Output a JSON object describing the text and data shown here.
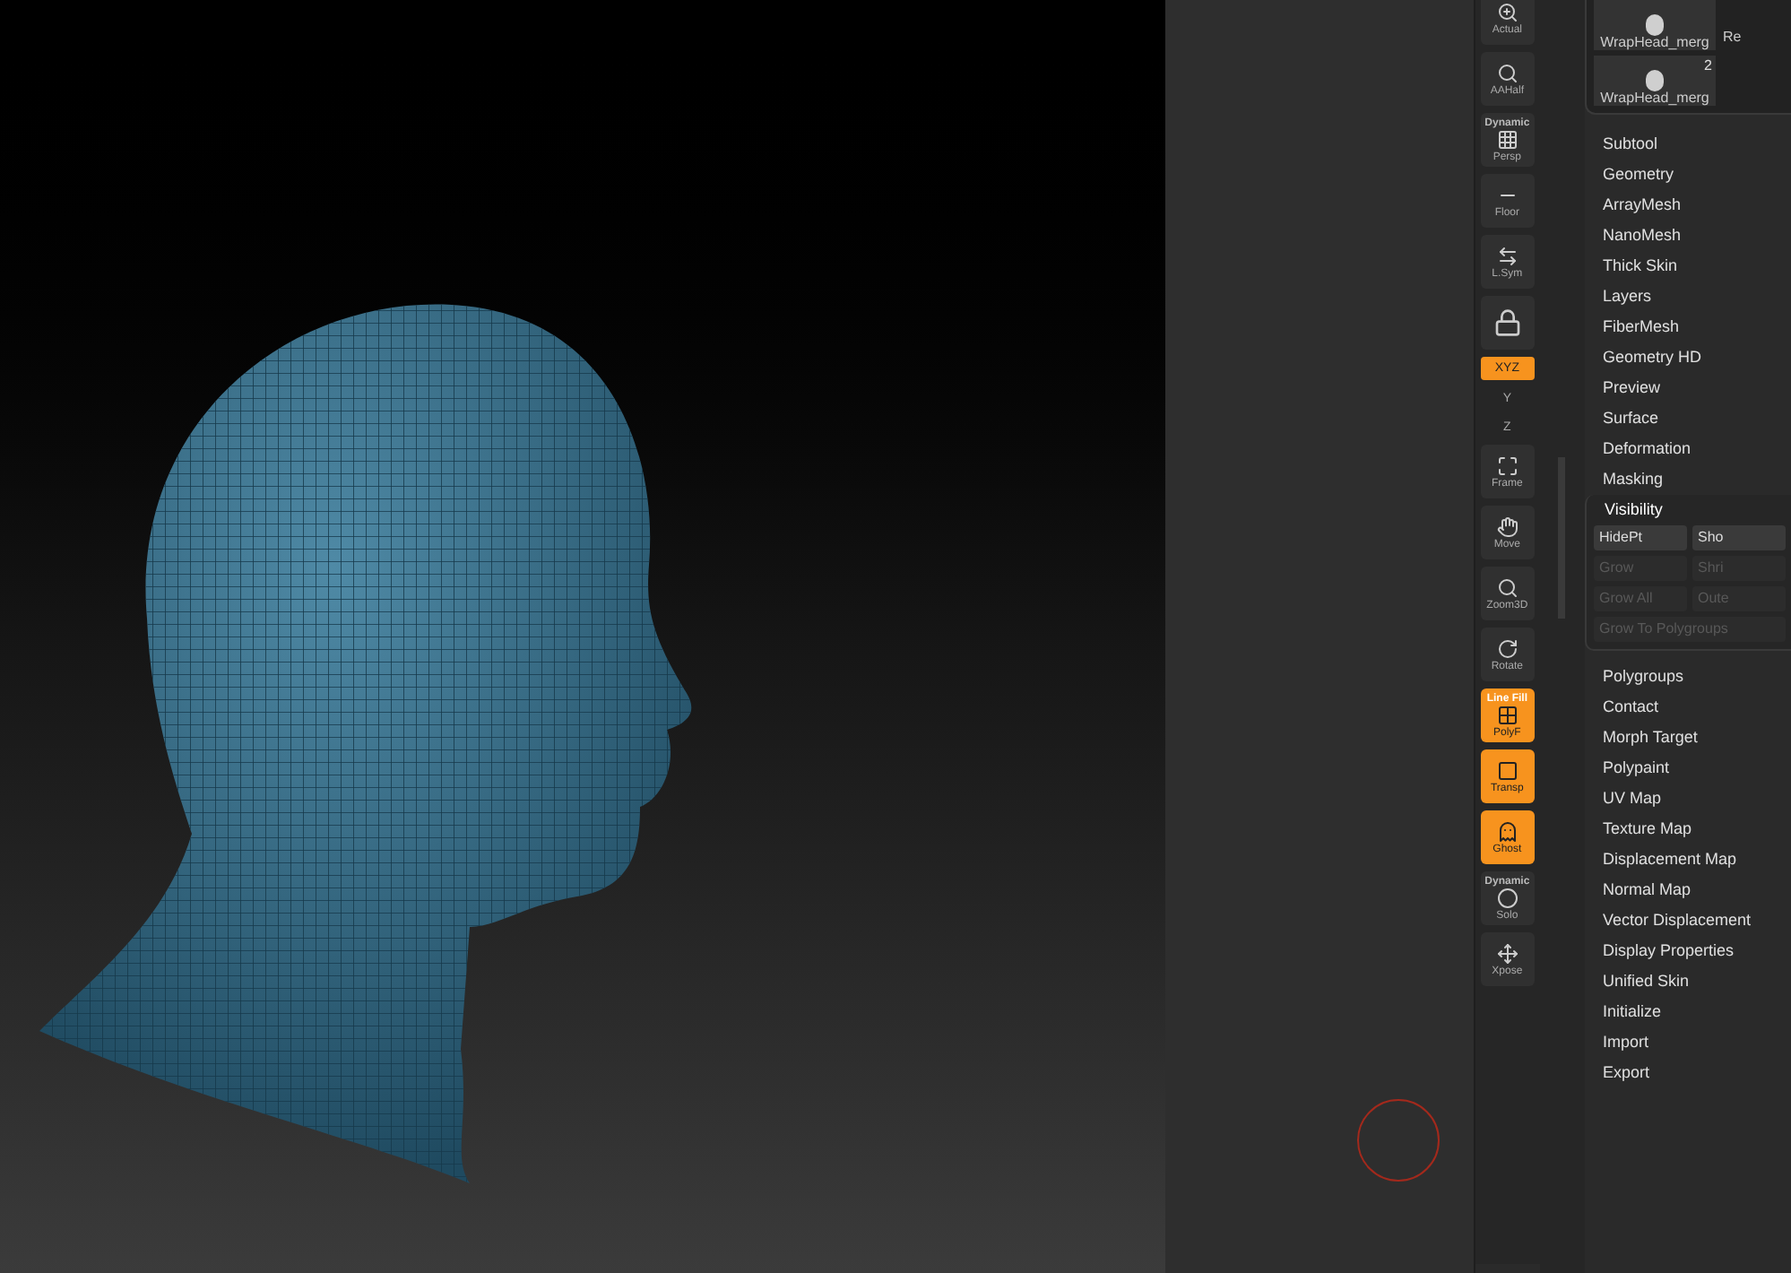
{
  "shelf": [
    {
      "kind": "button",
      "label": "Actual",
      "active": false
    },
    {
      "kind": "button",
      "label": "AAHalf",
      "active": false
    },
    {
      "kind": "button",
      "label": "Persp",
      "caption": "Dynamic",
      "active": false
    },
    {
      "kind": "button",
      "label": "Floor",
      "active": false
    },
    {
      "kind": "button",
      "label": "L.Sym",
      "active": false
    },
    {
      "kind": "icon",
      "active": false
    },
    {
      "kind": "pill",
      "label": "XYZ",
      "active": true
    },
    {
      "kind": "mini",
      "label": "Y",
      "active": false
    },
    {
      "kind": "mini",
      "label": "Z",
      "active": false
    },
    {
      "kind": "button",
      "label": "Frame",
      "active": false
    },
    {
      "kind": "button",
      "label": "Move",
      "active": false
    },
    {
      "kind": "button",
      "label": "Zoom3D",
      "active": false
    },
    {
      "kind": "button",
      "label": "Rotate",
      "active": false
    },
    {
      "kind": "button",
      "label": "PolyF",
      "caption": "Line Fill",
      "active": true
    },
    {
      "kind": "button",
      "label": "Transp",
      "active": true
    },
    {
      "kind": "button",
      "label": "Ghost",
      "active": true
    },
    {
      "kind": "button",
      "label": "Solo",
      "caption": "Dynamic",
      "active": false
    },
    {
      "kind": "button",
      "label": "Xpose",
      "active": false
    }
  ],
  "subtools": [
    {
      "name": "WrapHead_merg"
    },
    {
      "name": "WrapHead_merg",
      "count": "2"
    }
  ],
  "subtool_side_text": "Re",
  "menu": [
    {
      "label": "Subtool"
    },
    {
      "label": "Geometry"
    },
    {
      "label": "ArrayMesh"
    },
    {
      "label": "NanoMesh"
    },
    {
      "label": "Thick Skin"
    },
    {
      "label": "Layers"
    },
    {
      "label": "FiberMesh"
    },
    {
      "label": "Geometry HD"
    },
    {
      "label": "Preview"
    },
    {
      "label": "Surface"
    },
    {
      "label": "Deformation"
    },
    {
      "label": "Masking"
    },
    {
      "label": "Visibility",
      "expanded": true,
      "buttons": [
        {
          "label": "HidePt",
          "disabled": false,
          "wide": false
        },
        {
          "label": "Sho",
          "disabled": false,
          "wide": false
        },
        {
          "label": "Grow",
          "disabled": true,
          "wide": false
        },
        {
          "label": "Shri",
          "disabled": true,
          "wide": false
        },
        {
          "label": "Grow All",
          "disabled": true,
          "wide": false
        },
        {
          "label": "Oute",
          "disabled": true,
          "wide": false
        },
        {
          "label": "Grow To Polygroups",
          "disabled": true,
          "wide": true
        }
      ]
    },
    {
      "label": "Polygroups"
    },
    {
      "label": "Contact"
    },
    {
      "label": "Morph Target"
    },
    {
      "label": "Polypaint"
    },
    {
      "label": "UV Map"
    },
    {
      "label": "Texture Map"
    },
    {
      "label": "Displacement Map"
    },
    {
      "label": "Normal Map"
    },
    {
      "label": "Vector Displacement"
    },
    {
      "label": "Display Properties"
    },
    {
      "label": "Unified Skin"
    },
    {
      "label": "Initialize"
    },
    {
      "label": "Import"
    },
    {
      "label": "Export"
    }
  ]
}
